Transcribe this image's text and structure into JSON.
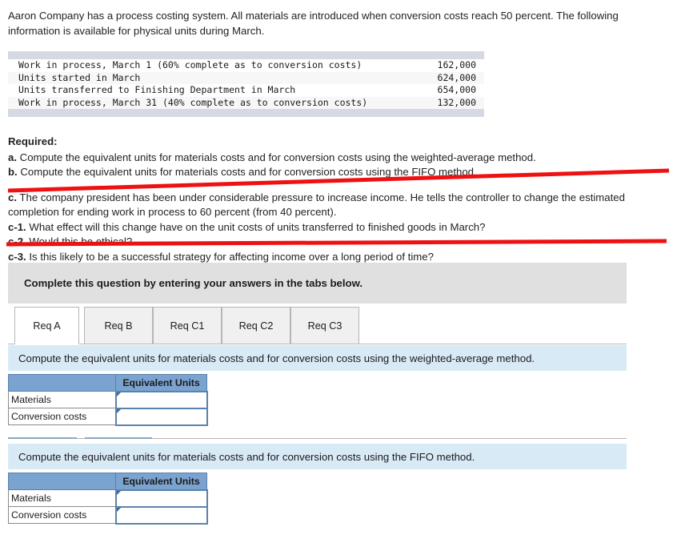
{
  "intro": {
    "paragraph": "Aaron Company has a process costing system. All materials are introduced when conversion costs reach 50 percent. The following information is available for physical units during March."
  },
  "facts_table": {
    "rows": [
      {
        "label": "Work in process, March 1 (60% complete as to conversion costs)",
        "value": "162,000"
      },
      {
        "label": "Units started in March",
        "value": "624,000"
      },
      {
        "label": "Units transferred to Finishing Department in March",
        "value": "654,000"
      },
      {
        "label": "Work in process, March 31 (40% complete as to conversion costs)",
        "value": "132,000"
      }
    ]
  },
  "required": {
    "heading": "Required:",
    "item_a_marker": "a.",
    "item_a_text": " Compute the equivalent units for materials costs and for conversion costs using the weighted-average method.",
    "item_b_marker": "b.",
    "item_b_text": " Compute the equivalent units for materials costs and for conversion costs using the FIFO method.",
    "item_c_marker": "c.",
    "item_c_text": " The company president has been under considerable pressure to increase income. He tells the controller to change the estimated completion for ending work in process to 60 percent (from 40 percent).",
    "item_c1_marker": "c-1.",
    "item_c1_text": " What effect will this change have on the unit costs of units transferred to finished goods in March?",
    "item_c2_marker": "c-2.",
    "item_c2_text": " Would this be ethical?",
    "item_c3_marker": "c-3.",
    "item_c3_text": " Is this likely to be a successful strategy for affecting income over a long period of time?"
  },
  "annotation": {
    "type": "red-x-strikethrough",
    "color": "#ee1111",
    "stroke_width": 4
  },
  "complete_box": {
    "text": "Complete this question by entering your answers in the tabs below."
  },
  "tabs": [
    {
      "label": "Req A",
      "active": true
    },
    {
      "label": "Req B",
      "active": false
    },
    {
      "label": "Req C1",
      "active": false
    },
    {
      "label": "Req C2",
      "active": false
    },
    {
      "label": "Req C3",
      "active": false
    }
  ],
  "panel_a": {
    "instruction": "Compute the equivalent units for materials costs and for conversion costs using the weighted-average method.",
    "table": {
      "header_blank": "",
      "header_units": "Equivalent Units",
      "rows": [
        {
          "label": "Materials",
          "value": ""
        },
        {
          "label": "Conversion costs",
          "value": ""
        }
      ]
    }
  },
  "panel_b": {
    "instruction": "Compute the equivalent units for materials costs and for conversion costs using the FIFO method.",
    "table": {
      "header_blank": "",
      "header_units": "Equivalent Units",
      "rows": [
        {
          "label": "Materials",
          "value": ""
        },
        {
          "label": "Conversion costs",
          "value": ""
        }
      ]
    }
  },
  "colors": {
    "header_blue": "#7ba3d0",
    "instruction_blue": "#d9eaf7",
    "complete_grey": "#e0e0e0",
    "facts_bar_grey": "#d5d9e2",
    "annotation_red": "#ee1111"
  }
}
